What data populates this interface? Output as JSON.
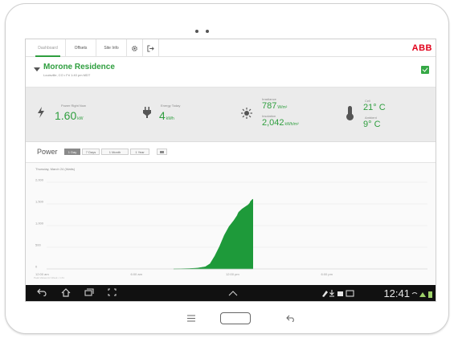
{
  "tabs": [
    {
      "label": "Dashboard",
      "active": true
    },
    {
      "label": "Offsets",
      "active": false
    },
    {
      "label": "Site Info",
      "active": false
    }
  ],
  "app_icons": {
    "settings": "gear-icon",
    "logout": "logout-icon"
  },
  "brand": {
    "logo_text": "ABB",
    "logo_color": "#e1001a"
  },
  "site": {
    "name": "Morone Residence",
    "subtitle": "Louisville, CO • Fri 1:40 pm MDT"
  },
  "stats": {
    "power": {
      "label": "Power Right Now",
      "value": "1.60",
      "unit": "kW",
      "icon": "lightning-icon"
    },
    "energy": {
      "label": "Energy Today",
      "value": "4",
      "unit": "kWh",
      "icon": "plug-icon"
    },
    "irradiance": {
      "label": "Irradiance",
      "value": "787",
      "unit": "W/m²",
      "icon": "sun-icon"
    },
    "insolation": {
      "label": "Insolation",
      "value": "2,042",
      "unit": "kWh/m²"
    },
    "cell": {
      "label": "Cell",
      "value": "21° C",
      "icon": "thermometer-icon"
    },
    "ambient": {
      "label": "Ambient",
      "value": "9° C"
    }
  },
  "power_section": {
    "title": "Power",
    "ranges": [
      "1 Day",
      "7 Days",
      "1 Month",
      "1 Year"
    ],
    "active_range": "1 Day",
    "calendar_icon": "calendar-icon"
  },
  "chart_data": {
    "type": "area",
    "title": "Thursday, March 24 (Watts)",
    "xlabel": "",
    "ylabel": "",
    "x_ticks": [
      "12:00 am",
      "6:00 am",
      "12:00 pm",
      "6:00 pm"
    ],
    "y_ticks": [
      "0",
      "500",
      "1,000",
      "1,500",
      "2,000"
    ],
    "xlim": [
      0,
      24
    ],
    "ylim": [
      0,
      2000
    ],
    "x": [
      8.0,
      8.5,
      9.0,
      9.5,
      10.0,
      10.3,
      10.6,
      10.9,
      11.2,
      11.5,
      11.8,
      12.0,
      12.1,
      12.3,
      12.5,
      12.7,
      12.8,
      12.85,
      12.9,
      12.95,
      13.0,
      13.0
    ],
    "series": [
      {
        "color": "#1e9a3a",
        "values": [
          0,
          5,
          10,
          20,
          50,
          120,
          300,
          520,
          780,
          980,
          1120,
          1230,
          1310,
          1380,
          1430,
          1480,
          1520,
          1560,
          1580,
          1600,
          1610,
          0
        ]
      }
    ],
    "grid": true
  },
  "footer_note": "Peak Values for Week • 1.61",
  "navbar": {
    "time": "12:41",
    "icons": [
      "back-icon",
      "home-icon",
      "recent-apps-icon",
      "screenshot-icon",
      "chevron-up-icon"
    ]
  },
  "hardware": {
    "menu_icon": "menu-icon",
    "back_icon": "back-icon"
  }
}
